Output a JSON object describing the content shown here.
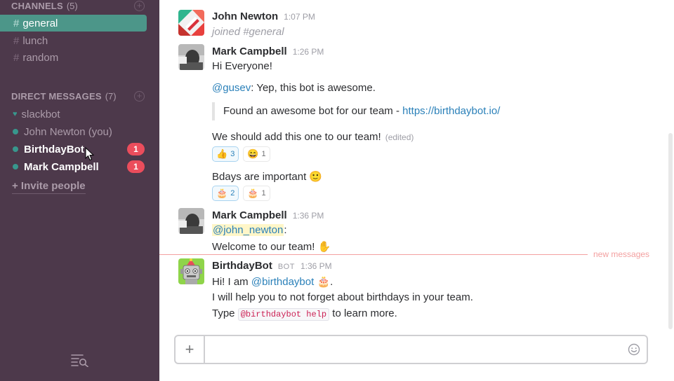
{
  "sidebar": {
    "channels_header": "CHANNELS",
    "channels_count": "(5)",
    "channels": [
      {
        "name": "general"
      },
      {
        "name": "lunch"
      },
      {
        "name": "random"
      }
    ],
    "dm_header": "DIRECT MESSAGES",
    "dm_count": "(7)",
    "dms": [
      {
        "name": "slackbot"
      },
      {
        "name": "John Newton (you)"
      },
      {
        "name": "BirthdayBot",
        "badge": "1"
      },
      {
        "name": "Mark Campbell",
        "badge": "1"
      }
    ],
    "invite": "+ Invite people",
    "hash": "#"
  },
  "messages": {
    "m1": {
      "author": "John Newton",
      "time": "1:07 PM",
      "text": "joined #general"
    },
    "m2": {
      "author": "Mark Campbell",
      "time": "1:26 PM",
      "line1": "Hi Everyone!",
      "line2_mention": "@gusev",
      "line2_rest": ": Yep, this bot is awesome.",
      "quote_text": "Found an awesome bot for our team - ",
      "quote_link": "https://birthdaybot.io/",
      "line3": "We should add this one to our team!",
      "edited": "(edited)",
      "reactions1": [
        {
          "emoji": "👍",
          "count": "3"
        },
        {
          "emoji": "😄",
          "count": "1"
        }
      ],
      "line4": "Bdays are important",
      "line4_emoji": "🙂",
      "reactions2": [
        {
          "emoji": "🎂",
          "count": "2"
        },
        {
          "emoji": "🎂",
          "count": "1"
        }
      ]
    },
    "m3": {
      "author": "Mark Campbell",
      "time": "1:36 PM",
      "mention": "@john_newton",
      "colon": ":",
      "line2": "Welcome to our team!",
      "line2_emoji": "✋"
    },
    "new_messages": "new messages",
    "m4": {
      "author": "BirthdayBot",
      "tag": "BOT",
      "time": "1:36 PM",
      "l1_pre": "Hi! I am ",
      "l1_mention": "@birthdaybot",
      "l1_emoji": "🎂",
      "l1_post": ".",
      "l2": "I will help you to not forget about birthdays in your team.",
      "l3_pre": "Type ",
      "l3_code": "@birthdaybot help",
      "l3_post": " to learn more."
    }
  },
  "composer": {
    "plus": "+",
    "placeholder": ""
  },
  "colors": {
    "sidebar": "#4d394b",
    "active": "#4c9689",
    "badge": "#eb4d5c",
    "link": "#2a80b9"
  }
}
